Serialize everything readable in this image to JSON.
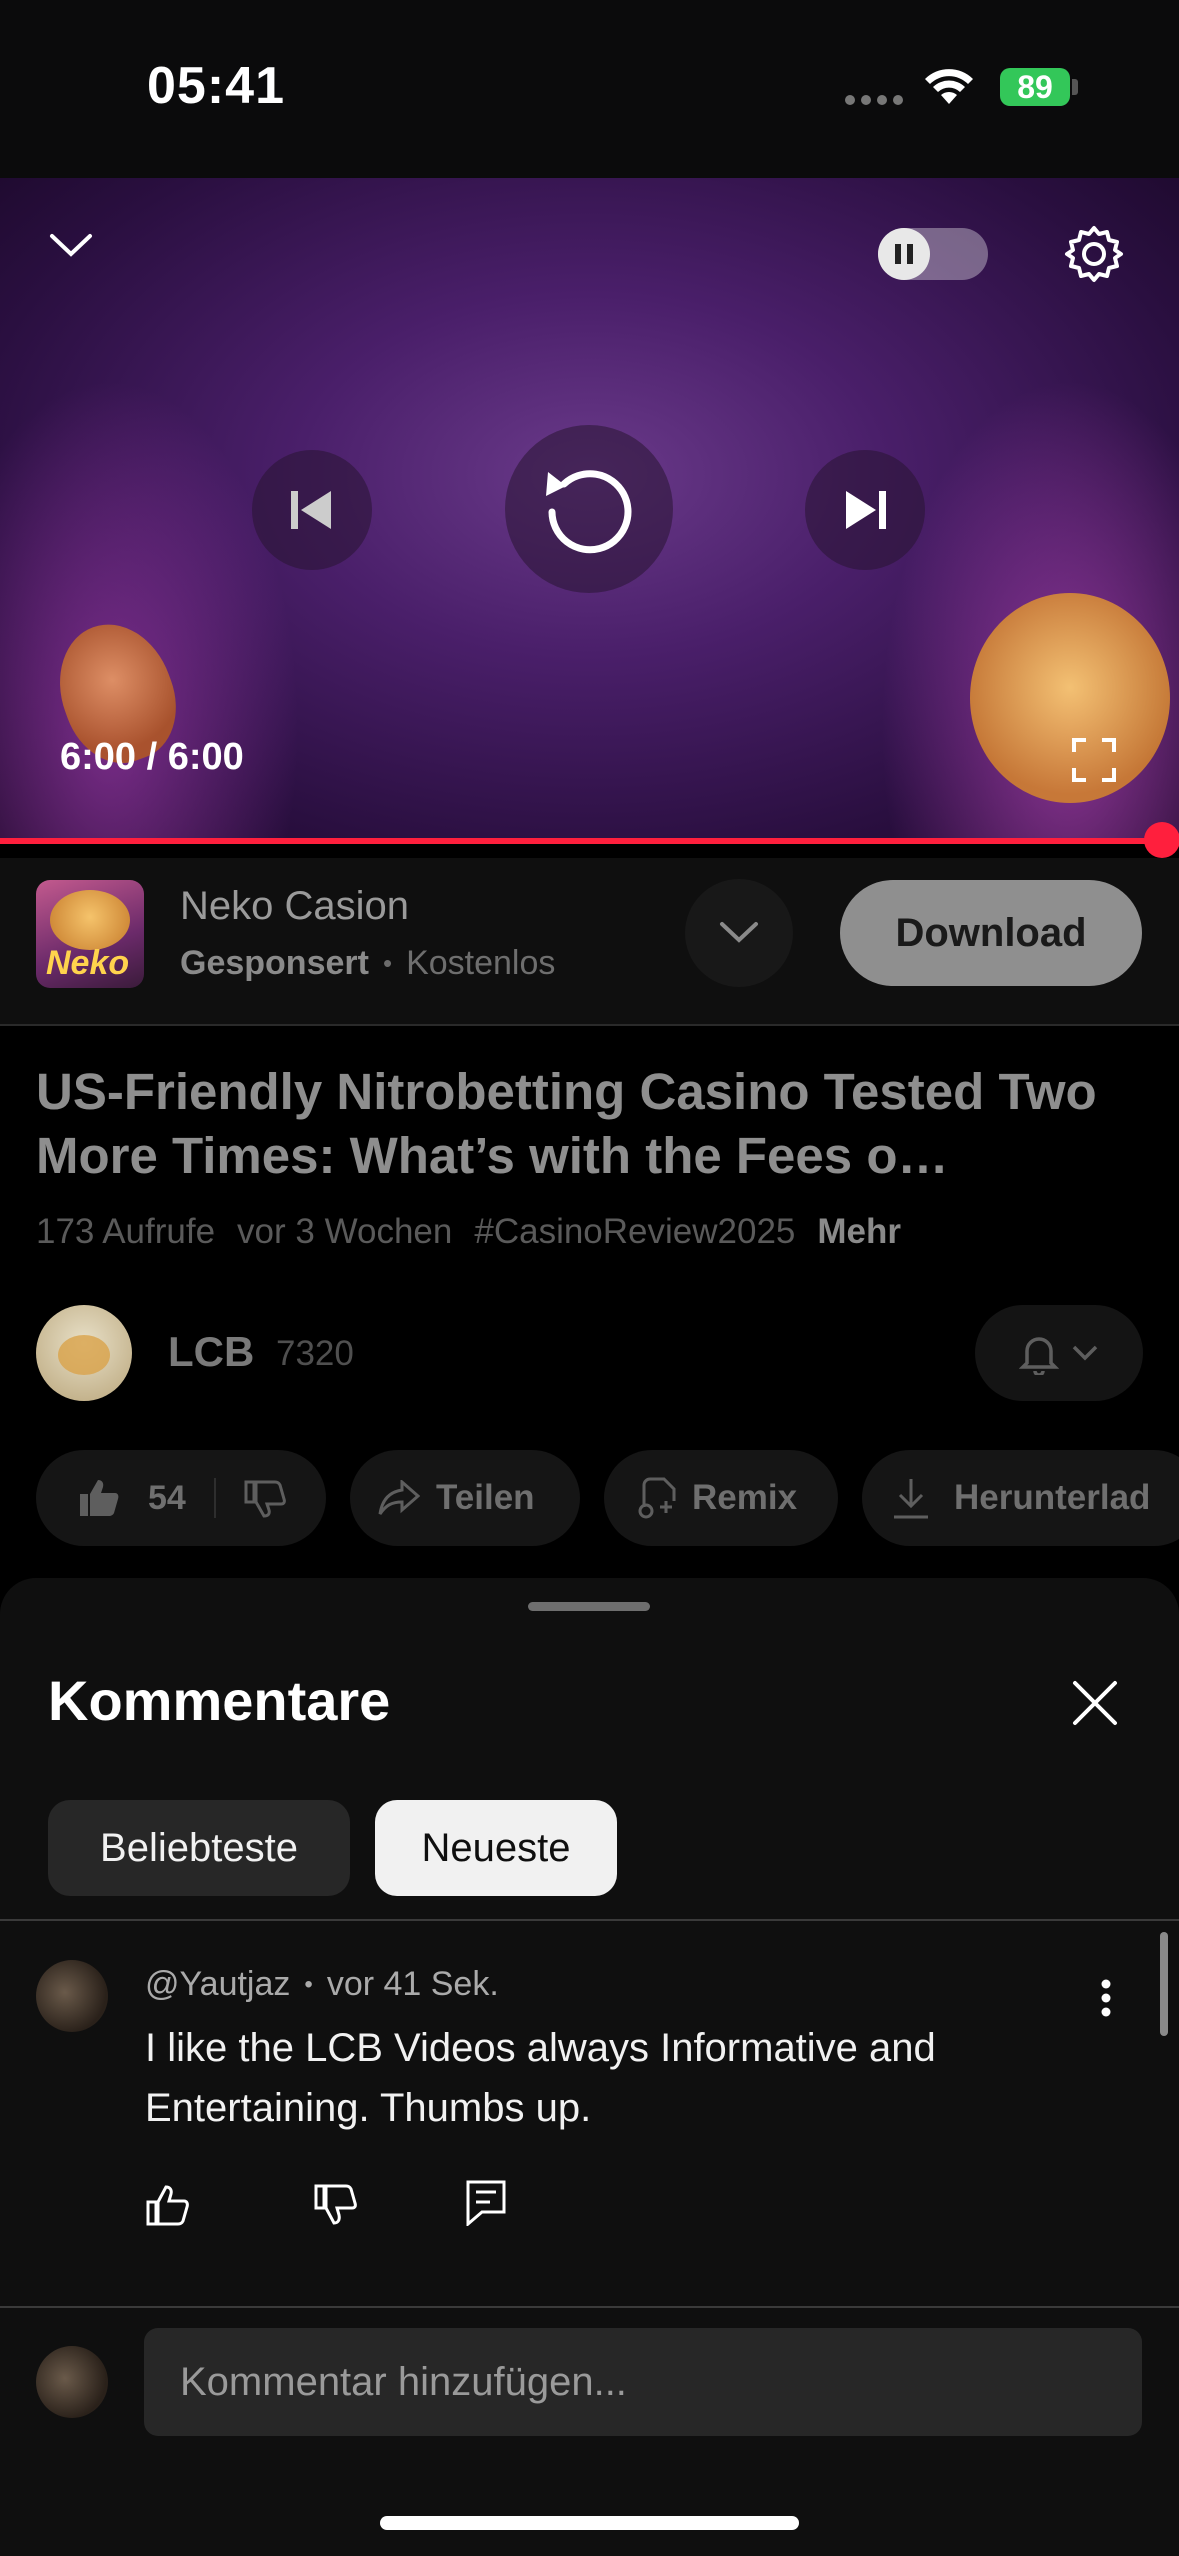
{
  "status_bar": {
    "time": "05:41",
    "battery": "89"
  },
  "player": {
    "time_display": "6:00 / 6:00",
    "progress": 1.0
  },
  "ad": {
    "title": "Neko Casion",
    "sponsored": "Gesponsert",
    "separator": "•",
    "price": "Kostenlos",
    "thumb_text": "Neko",
    "download_label": "Download"
  },
  "video": {
    "title": "US-Friendly Nitrobetting Casino Tested Two More Times: What’s with the Fees o…",
    "views": "173 Aufrufe",
    "age": "vor 3 Wochen",
    "hashtag": "#CasinoReview2025",
    "more": "Mehr"
  },
  "channel": {
    "name": "LCB",
    "subscribers": "7320"
  },
  "actions": {
    "likes": "54",
    "share": "Teilen",
    "remix": "Remix",
    "download": "Herunterlad"
  },
  "comments": {
    "title": "Kommentare",
    "tabs": [
      {
        "label": "Beliebteste",
        "selected": false
      },
      {
        "label": "Neueste",
        "selected": true
      }
    ],
    "items": [
      {
        "author": "@Yautjaz",
        "separator": "•",
        "time": "vor 41 Sek.",
        "text": "I like the LCB Videos always Informative and Entertaining. Thumbs up."
      }
    ],
    "input_placeholder": "Kommentar hinzufügen..."
  },
  "colors": {
    "accent_red": "#ff1f3d",
    "battery_green": "#33c759",
    "chip_bg": "#272727"
  }
}
